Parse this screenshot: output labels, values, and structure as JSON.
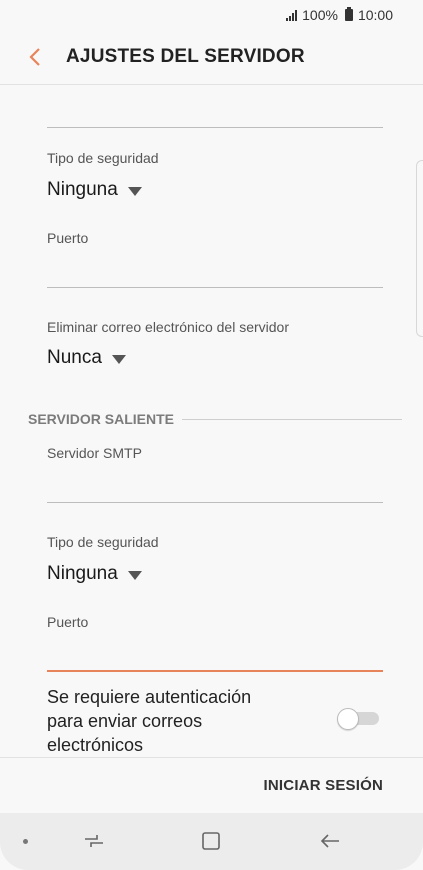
{
  "status_bar": {
    "battery": "100%",
    "time": "10:00"
  },
  "header": {
    "title": "AJUSTES DEL SERVIDOR"
  },
  "incoming": {
    "security_type_label": "Tipo de seguridad",
    "security_type_value": "Ninguna",
    "port_label": "Puerto",
    "port_value": "",
    "delete_label": "Eliminar correo electrónico del servidor",
    "delete_value": "Nunca"
  },
  "outgoing": {
    "section_title": "SERVIDOR SALIENTE",
    "smtp_label": "Servidor SMTP",
    "smtp_value": "",
    "security_type_label": "Tipo de seguridad",
    "security_type_value": "Ninguna",
    "port_label": "Puerto",
    "port_value": "",
    "auth_text": "Se requiere autenticación para enviar correos electrónicos",
    "auth_enabled": false
  },
  "footer": {
    "signin_label": "INICIAR SESIÓN"
  },
  "colors": {
    "accent": "#e8845a",
    "background": "#f8f8f8",
    "text": "#222222"
  },
  "icons": {
    "back": "chevron-left-icon",
    "caret": "caret-down-icon",
    "signal": "signal-icon",
    "battery": "battery-icon",
    "nav_recent": "recent-apps-icon",
    "nav_home": "home-icon",
    "nav_back": "back-arrow-icon"
  }
}
